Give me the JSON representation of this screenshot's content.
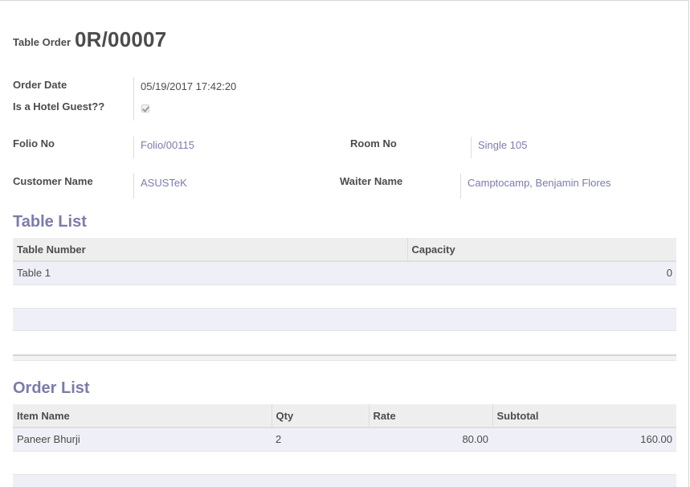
{
  "header": {
    "title_label": "Table Order",
    "title_value": "0R/00007"
  },
  "fields": {
    "order_date_label": "Order Date",
    "order_date_value": "05/19/2017 17:42:20",
    "hotel_guest_label": "Is a Hotel Guest??",
    "hotel_guest_checked": true,
    "folio_label": "Folio No",
    "folio_value": "Folio/00115",
    "room_label": "Room No",
    "room_value": "Single 105",
    "customer_label": "Customer Name",
    "customer_value": "ASUSTeK",
    "waiter_label": "Waiter Name",
    "waiter_value": "Camptocamp, Benjamin Flores"
  },
  "table_list": {
    "title": "Table List",
    "columns": [
      "Table Number",
      "Capacity"
    ],
    "rows": [
      {
        "table_number": "Table 1",
        "capacity": "0"
      }
    ]
  },
  "order_list": {
    "title": "Order List",
    "columns": [
      "Item Name",
      "Qty",
      "Rate",
      "Subtotal"
    ],
    "rows": [
      {
        "item_name": "Paneer Bhurji",
        "qty": "2",
        "rate": "80.00",
        "subtotal": "160.00"
      }
    ]
  },
  "colors": {
    "accent": "#7c7bad",
    "row_bg": "#efeff8",
    "header_bg": "#eeeeee"
  }
}
